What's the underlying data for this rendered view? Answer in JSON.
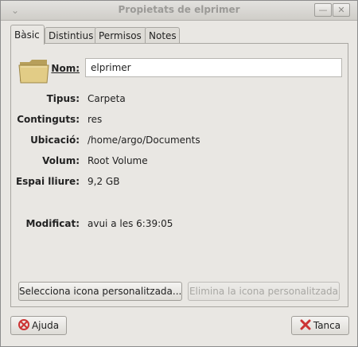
{
  "window": {
    "title": "Propietats de elprimer",
    "menu_glyph": "⌄",
    "minimize_glyph": "—",
    "close_glyph": "✕"
  },
  "tabs": [
    {
      "label": "Bàsic"
    },
    {
      "label": "Distintius"
    },
    {
      "label": "Permisos"
    },
    {
      "label": "Notes"
    }
  ],
  "basic": {
    "name_label": "Nom:",
    "name_value": "elprimer",
    "folder_icon": "folder-icon",
    "rows": [
      {
        "label": "Tipus:",
        "value": "Carpeta"
      },
      {
        "label": "Continguts:",
        "value": "res"
      },
      {
        "label": "Ubicació:",
        "value": "/home/argo/Documents"
      },
      {
        "label": "Volum:",
        "value": "Root Volume"
      },
      {
        "label": "Espai lliure:",
        "value": "9,2 GB"
      }
    ],
    "modified": {
      "label": "Modificat:",
      "value": "avui a les 6:39:05"
    },
    "select_icon_button": "Selecciona icona personalitzada...",
    "remove_icon_button": "Elimina la icona personalitzada"
  },
  "footer": {
    "help_label": "Ajuda",
    "close_label": "Tanca"
  },
  "colors": {
    "window_bg": "#e9e7e3",
    "close_icon_red": "#cc3333",
    "folder_tan": "#d8c27a"
  }
}
